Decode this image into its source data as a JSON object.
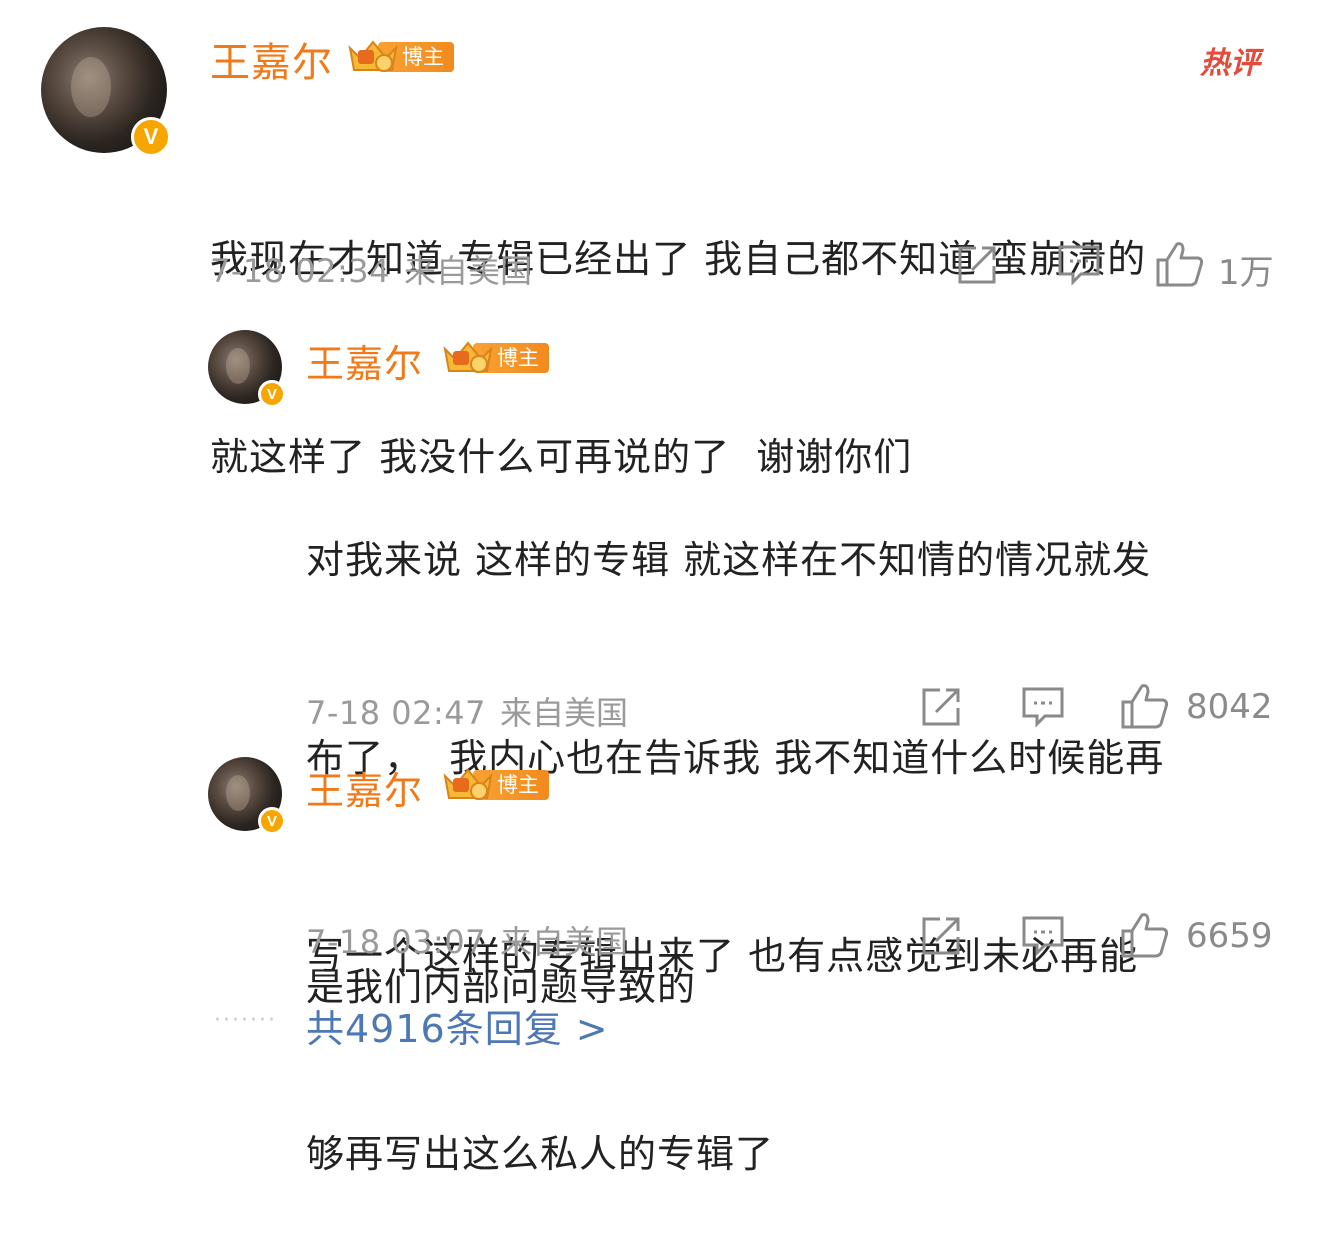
{
  "hot_tag": "热评",
  "main_comment": {
    "user": "王嘉尔",
    "badge": "博主",
    "lines": [
      "我现在才知道 专辑已经出了 我自己都不知道 蛮崩溃的",
      "就这样了 我没什么可再说的了  谢谢你们"
    ],
    "time": "7-18 02:34",
    "location": "来自美国",
    "likes": "1万"
  },
  "replies": [
    {
      "user": "王嘉尔",
      "badge": "博主",
      "lines": [
        "对我来说 这样的专辑 就这样在不知情的情况就发",
        "布了，  我内心也在告诉我 我不知道什么时候能再",
        "写一个这样的专辑出来了 也有点感觉到未必再能",
        "够再写出这么私人的专辑了"
      ],
      "time": "7-18 02:47",
      "location": "来自美国",
      "likes": "8042"
    },
    {
      "user": "王嘉尔",
      "badge": "博主",
      "lines": [
        "是我们内部问题导致的"
      ],
      "time": "7-18 03:07",
      "location": "来自美国",
      "likes": "6659"
    }
  ],
  "more_replies": "共4916条回复 >",
  "icons": {
    "share": "share-icon",
    "comment": "comment-icon",
    "like": "thumbs-up-icon",
    "verified": "verified-v-icon",
    "crown": "crown-icon"
  },
  "colors": {
    "username": "#f07a1a",
    "badge": "#f28a1e",
    "hot": "#e34b3b",
    "link": "#4d78b5",
    "meta": "#9a9a9a"
  }
}
